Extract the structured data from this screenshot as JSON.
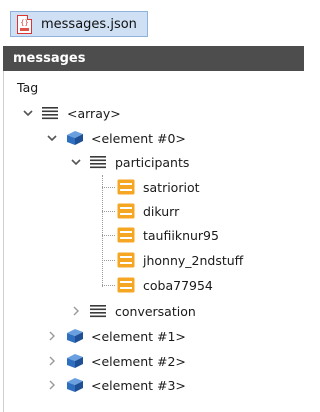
{
  "tab": {
    "filename": "messages.json",
    "icon": "json-file-icon"
  },
  "panel": {
    "title": "messages",
    "column_header": "Tag"
  },
  "tree": {
    "root": {
      "label": "<array>",
      "icon": "array-icon",
      "state": "expanded"
    },
    "element0": {
      "label": "<element #0>",
      "icon": "object-cube-icon",
      "state": "expanded"
    },
    "participants": {
      "label": "participants",
      "icon": "array-icon",
      "state": "expanded"
    },
    "participant_items": [
      "satrioriot",
      "dikurr",
      "taufiiknur95",
      "jhonny_2ndstuff",
      "coba77954"
    ],
    "conversation": {
      "label": "conversation",
      "icon": "array-icon",
      "state": "collapsed"
    },
    "element1": {
      "label": "<element #1>",
      "icon": "object-cube-icon",
      "state": "collapsed"
    },
    "element2": {
      "label": "<element #2>",
      "icon": "object-cube-icon",
      "state": "collapsed"
    },
    "element3": {
      "label": "<element #3>",
      "icon": "object-cube-icon",
      "state": "collapsed"
    }
  },
  "colors": {
    "string_icon": "#f5a623",
    "cube_icon": "#2f6fbf",
    "header_bg": "#4d4d4d",
    "tab_bg": "#cfe0f4"
  }
}
